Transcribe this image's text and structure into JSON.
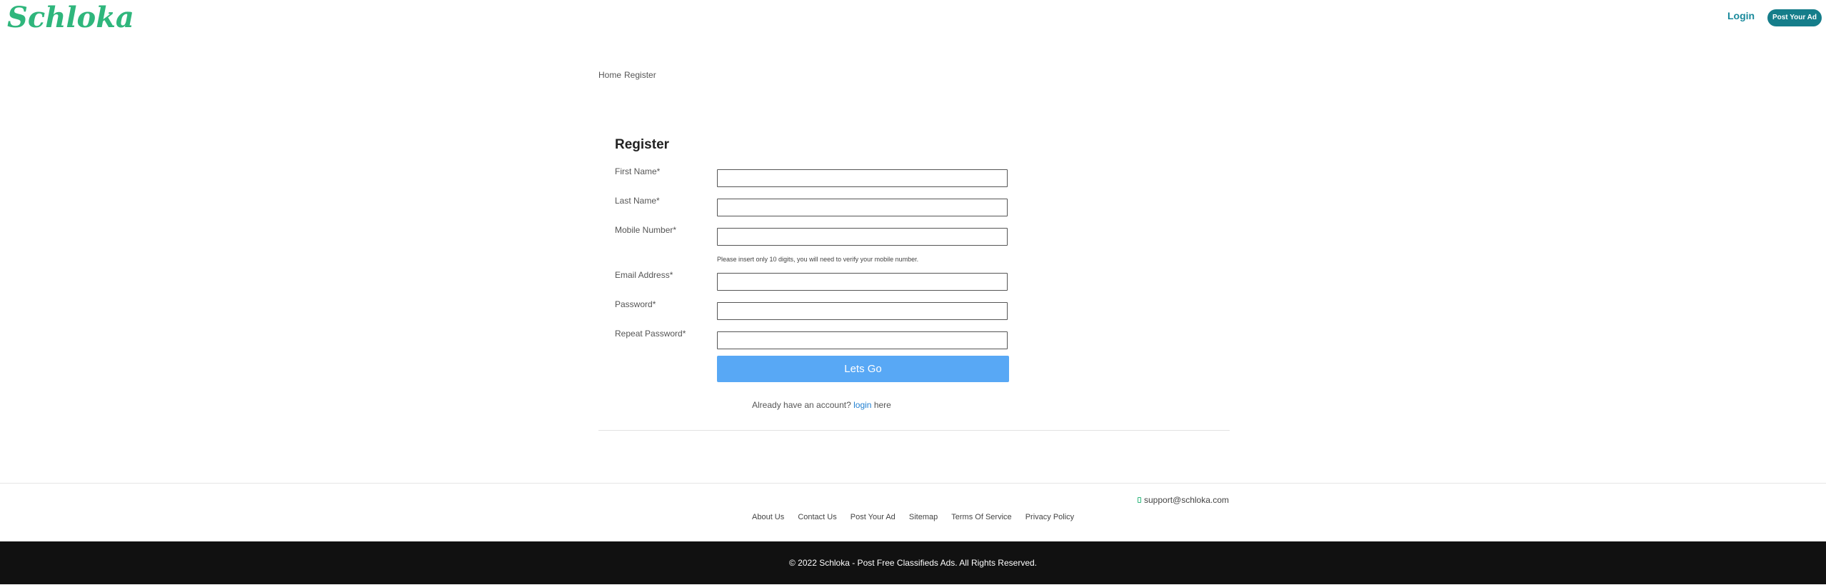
{
  "header": {
    "logo": "Schloka",
    "login_label": "Login",
    "post_ad_label": "Post Your Ad",
    "brand_color": "#2fb67c",
    "button_color": "#157d8a"
  },
  "breadcrumb": {
    "items": [
      "Home",
      "Register"
    ]
  },
  "form": {
    "title": "Register",
    "fields": [
      {
        "label": "First Name*",
        "value": ""
      },
      {
        "label": "Last Name*",
        "value": ""
      },
      {
        "label": "Mobile Number*",
        "value": ""
      },
      {
        "label": "Email Address*",
        "value": ""
      },
      {
        "label": "Password*",
        "value": ""
      },
      {
        "label": "Repeat Password*",
        "value": ""
      }
    ],
    "mobile_hint": "Please insert only 10 digits, you will need to verify your mobile number.",
    "submit_label": "Lets Go",
    "submit_color": "#58a8f5",
    "account_prefix": "Already have an account?",
    "account_link": "login",
    "account_suffix": "here"
  },
  "footer": {
    "support_icon": "phone-icon",
    "support_email": "support@schloka.com",
    "links": [
      "About Us",
      "Contact Us",
      "Post Your Ad",
      "Sitemap",
      "Terms Of Service",
      "Privacy Policy"
    ],
    "copyright": "© 2022 Schloka - Post Free Classifieds Ads. All Rights Reserved."
  }
}
